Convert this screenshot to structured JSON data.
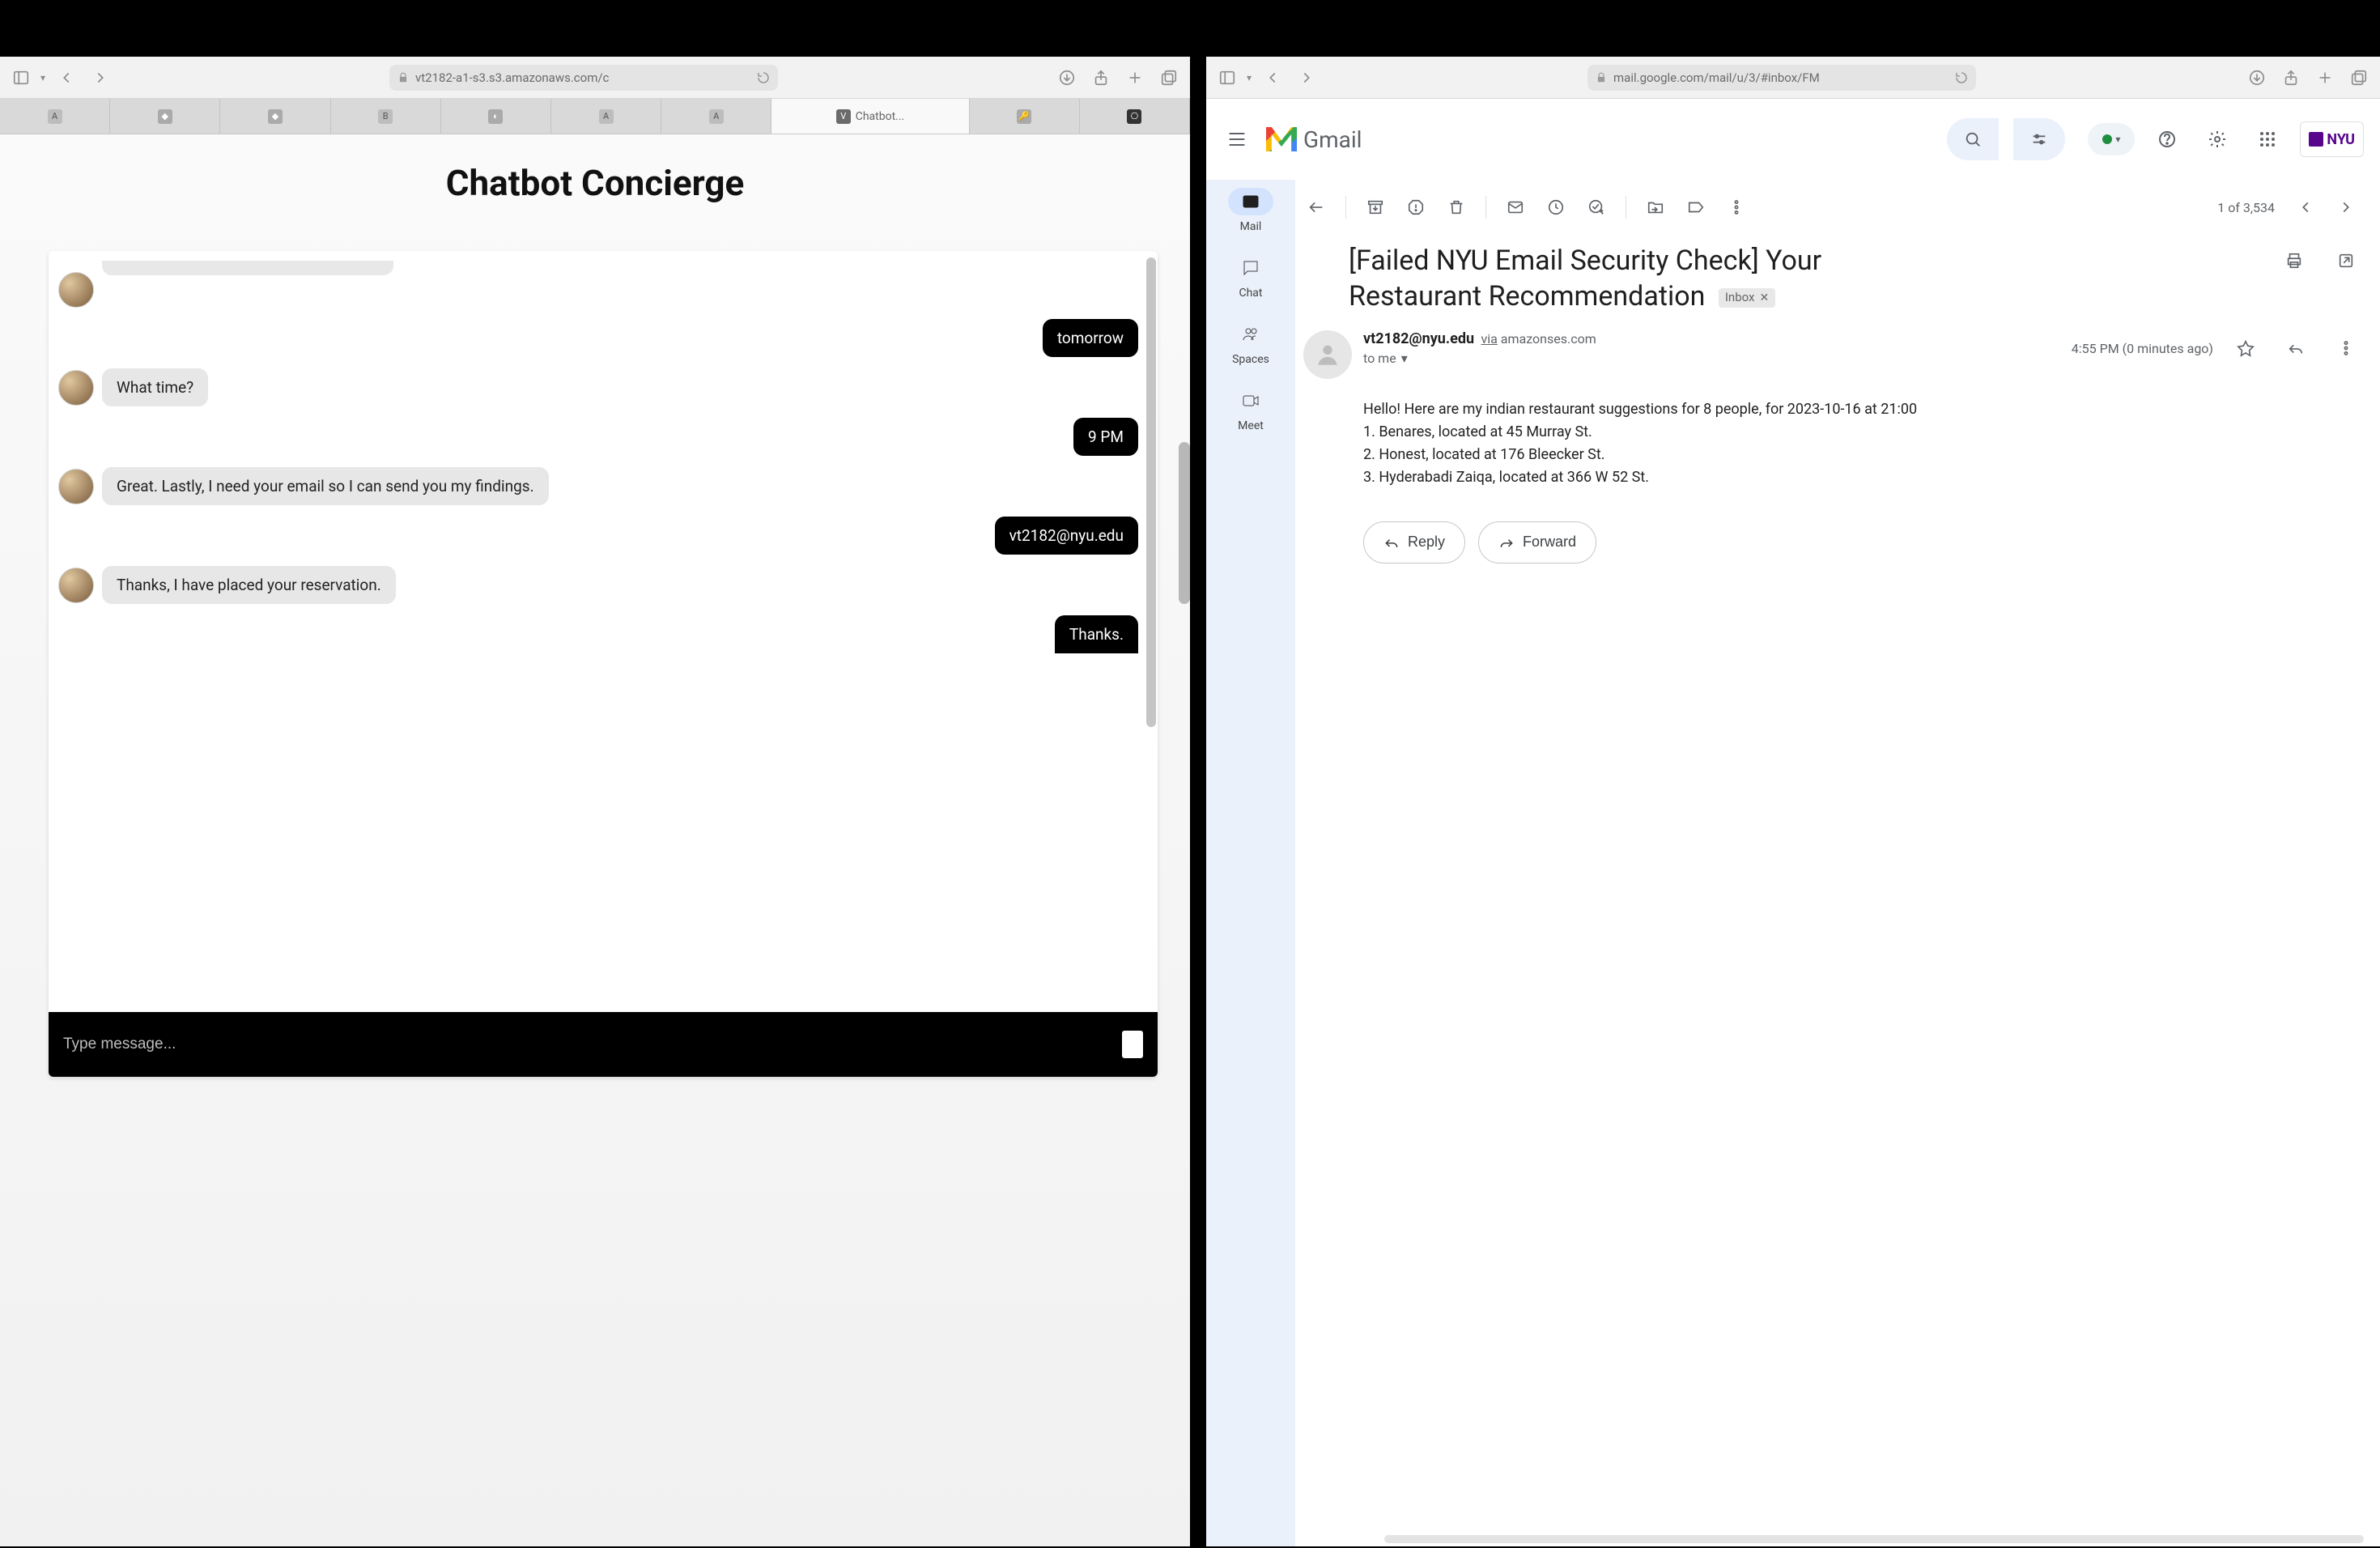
{
  "left": {
    "url": "vt2182-a1-s3.s3.amazonaws.com/c",
    "tabs": {
      "active_label": "Chatbot..."
    },
    "page_title": "Chatbot Concierge",
    "messages": [
      {
        "who": "bot",
        "partial": true,
        "text": ""
      },
      {
        "who": "user",
        "text": "tomorrow"
      },
      {
        "who": "bot",
        "text": "What time?"
      },
      {
        "who": "user",
        "text": "9 PM"
      },
      {
        "who": "bot",
        "text": "Great. Lastly, I need your email so I can send you my findings."
      },
      {
        "who": "user",
        "text": "vt2182@nyu.edu"
      },
      {
        "who": "bot",
        "text": "Thanks, I have placed your reservation."
      },
      {
        "who": "user",
        "text": "Thanks."
      }
    ],
    "input_placeholder": "Type message..."
  },
  "right": {
    "url": "mail.google.com/mail/u/3/#inbox/FM",
    "brand": "Gmail",
    "rail": {
      "mail": "Mail",
      "chat": "Chat",
      "spaces": "Spaces",
      "meet": "Meet"
    },
    "count": "1 of 3,534",
    "subject_line1": "[Failed NYU Email Security Check] Your",
    "subject_line2": "Restaurant Recommendation",
    "inbox_chip": "Inbox",
    "sender_email": "vt2182@nyu.edu",
    "via_label": "via",
    "via_domain": "amazonses.com",
    "timestamp": "4:55 PM (0 minutes ago)",
    "to_text": "to me",
    "body_lines": [
      "Hello! Here are my indian restaurant suggestions for 8 people, for 2023-10-16 at 21:00",
      "1. Benares, located at 45 Murray St.",
      "2. Honest, located at 176 Bleecker St.",
      "3. Hyderabadi Zaiqa, located at 366 W 52 St."
    ],
    "reply_label": "Reply",
    "forward_label": "Forward",
    "org_chip": "NYU"
  }
}
